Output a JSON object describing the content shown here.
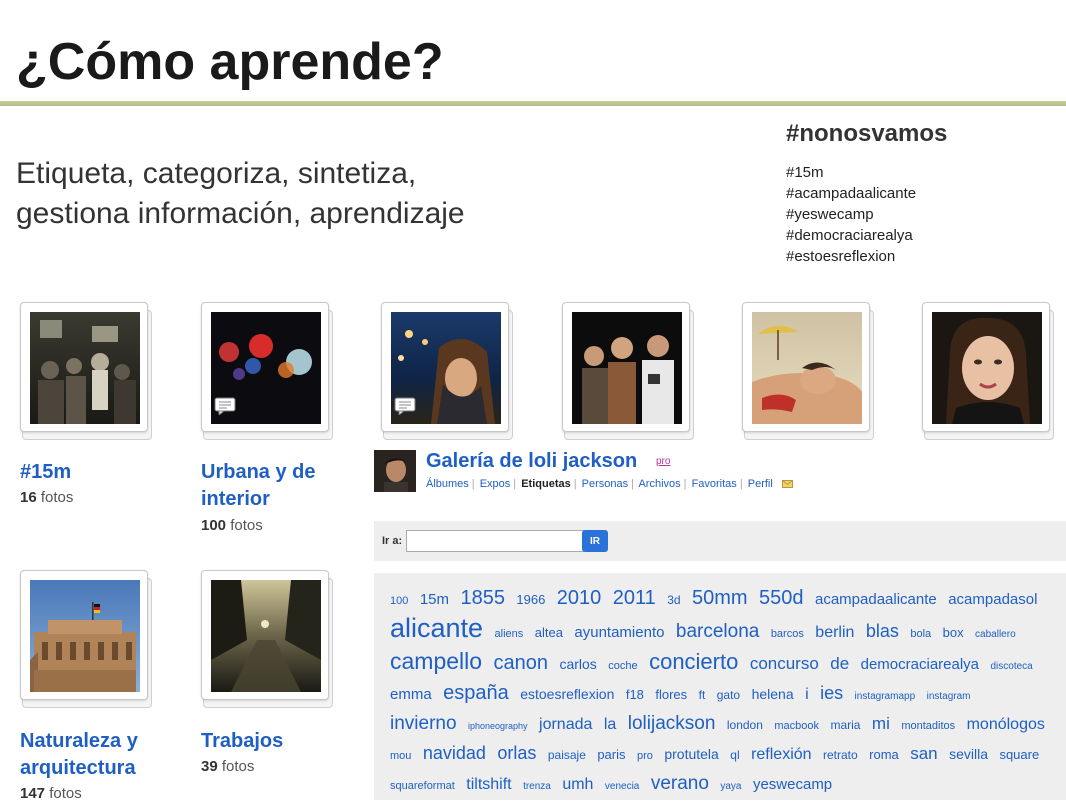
{
  "slide": {
    "title": "¿Cómo aprende?",
    "subtitle_line1": "Etiqueta, categoriza, sintetiza,",
    "subtitle_line2": "gestiona información, aprendizaje"
  },
  "hashtags": {
    "main": "#nonosvamos",
    "list": [
      "#15m",
      "#acampadaalicante",
      "#yeswecamp",
      "#democraciarealya",
      "#estoesreflexion"
    ]
  },
  "albums": [
    {
      "title_line1": "#15m",
      "title_line2": "",
      "count": "16",
      "count_label": "fotos"
    },
    {
      "title_line1": "Urbana y de",
      "title_line2": "interior",
      "count": "100",
      "count_label": "fotos"
    },
    {
      "title_line1": "Naturaleza y",
      "title_line2": "arquitectura",
      "count": "147",
      "count_label": "fotos"
    },
    {
      "title_line1": "Trabajos",
      "title_line2": "",
      "count": "39",
      "count_label": "fotos"
    }
  ],
  "gallery": {
    "title": "Galería de loli jackson",
    "badge": "pro",
    "nav": [
      "Álbumes",
      "Expos",
      "Etiquetas",
      "Personas",
      "Archivos",
      "Favoritas",
      "Perfil"
    ],
    "active_nav": "Etiquetas"
  },
  "goto": {
    "label": "Ir a:",
    "value": "",
    "button": "IR"
  },
  "tag_cloud": {
    "tags": [
      {
        "text": "100",
        "size": 11
      },
      {
        "text": "15m",
        "size": 15
      },
      {
        "text": "1855",
        "size": 20
      },
      {
        "text": "1966",
        "size": 13
      },
      {
        "text": "2010",
        "size": 20
      },
      {
        "text": "2011",
        "size": 20
      },
      {
        "text": "3d",
        "size": 12
      },
      {
        "text": "50mm",
        "size": 20
      },
      {
        "text": "550d",
        "size": 20
      },
      {
        "text": "acampadaalicante",
        "size": 15
      },
      {
        "text": "acampadasol",
        "size": 15
      },
      {
        "text": "alicante",
        "size": 27
      },
      {
        "text": "aliens",
        "size": 11
      },
      {
        "text": "altea",
        "size": 13
      },
      {
        "text": "ayuntamiento",
        "size": 15
      },
      {
        "text": "barcelona",
        "size": 19
      },
      {
        "text": "barcos",
        "size": 11
      },
      {
        "text": "berlin",
        "size": 16
      },
      {
        "text": "blas",
        "size": 18
      },
      {
        "text": "bola",
        "size": 11
      },
      {
        "text": "box",
        "size": 13
      },
      {
        "text": "caballero",
        "size": 10
      },
      {
        "text": "campello",
        "size": 23
      },
      {
        "text": "canon",
        "size": 20
      },
      {
        "text": "carlos",
        "size": 14
      },
      {
        "text": "coche",
        "size": 11
      },
      {
        "text": "concierto",
        "size": 22
      },
      {
        "text": "concurso",
        "size": 17
      },
      {
        "text": "de",
        "size": 17
      },
      {
        "text": "democraciarealya",
        "size": 15
      },
      {
        "text": "discoteca",
        "size": 10
      },
      {
        "text": "emma",
        "size": 15
      },
      {
        "text": "españa",
        "size": 20
      },
      {
        "text": "estoesreflexion",
        "size": 14
      },
      {
        "text": "f18",
        "size": 13
      },
      {
        "text": "flores",
        "size": 13
      },
      {
        "text": "ft",
        "size": 12
      },
      {
        "text": "gato",
        "size": 12
      },
      {
        "text": "helena",
        "size": 14
      },
      {
        "text": "i",
        "size": 16
      },
      {
        "text": "ies",
        "size": 18
      },
      {
        "text": "instagramapp",
        "size": 10
      },
      {
        "text": "instagram",
        "size": 10
      },
      {
        "text": "invierno",
        "size": 19
      },
      {
        "text": "iphoneography",
        "size": 9
      },
      {
        "text": "jornada",
        "size": 16
      },
      {
        "text": "la",
        "size": 16
      },
      {
        "text": "lolijackson",
        "size": 19
      },
      {
        "text": "london",
        "size": 12
      },
      {
        "text": "macbook",
        "size": 11
      },
      {
        "text": "maria",
        "size": 12
      },
      {
        "text": "mi",
        "size": 17
      },
      {
        "text": "montaditos",
        "size": 11
      },
      {
        "text": "monólogos",
        "size": 16
      },
      {
        "text": "mou",
        "size": 11
      },
      {
        "text": "navidad",
        "size": 18
      },
      {
        "text": "orlas",
        "size": 18
      },
      {
        "text": "paisaje",
        "size": 12
      },
      {
        "text": "paris",
        "size": 13
      },
      {
        "text": "pro",
        "size": 11
      },
      {
        "text": "protutela",
        "size": 14
      },
      {
        "text": "ql",
        "size": 12
      },
      {
        "text": "reflexión",
        "size": 16
      },
      {
        "text": "retrato",
        "size": 12
      },
      {
        "text": "roma",
        "size": 13
      },
      {
        "text": "san",
        "size": 17
      },
      {
        "text": "sevilla",
        "size": 14
      },
      {
        "text": "square",
        "size": 13
      },
      {
        "text": "squareformat",
        "size": 11
      },
      {
        "text": "tiltshift",
        "size": 16
      },
      {
        "text": "trenza",
        "size": 10
      },
      {
        "text": "umh",
        "size": 16
      },
      {
        "text": "venecia",
        "size": 10
      },
      {
        "text": "verano",
        "size": 19
      },
      {
        "text": "yaya",
        "size": 10
      },
      {
        "text": "yeswecamp",
        "size": 15
      }
    ]
  }
}
